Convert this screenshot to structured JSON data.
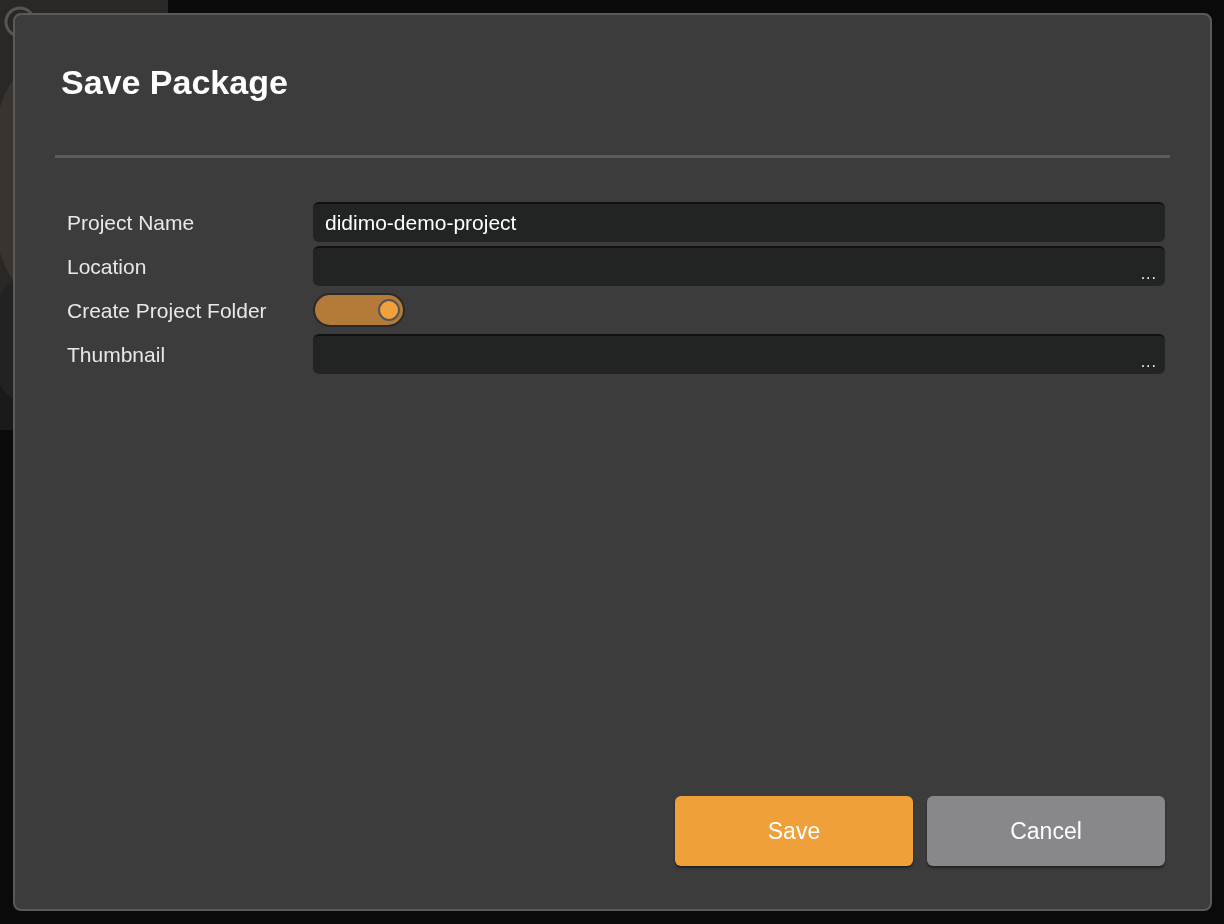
{
  "dialog": {
    "title": "Save Package"
  },
  "fields": [
    {
      "kind": "text",
      "label": "Project Name",
      "value": "didimo-demo-project"
    },
    {
      "kind": "path",
      "label": "Location",
      "browse": "..."
    },
    {
      "kind": "toggle",
      "label": "Create Project Folder",
      "on": true
    },
    {
      "kind": "path",
      "label": "Thumbnail",
      "browse": "..."
    }
  ],
  "buttons": [
    {
      "label": "Save",
      "kind": "primary"
    },
    {
      "label": "Cancel",
      "kind": "secondary"
    }
  ]
}
